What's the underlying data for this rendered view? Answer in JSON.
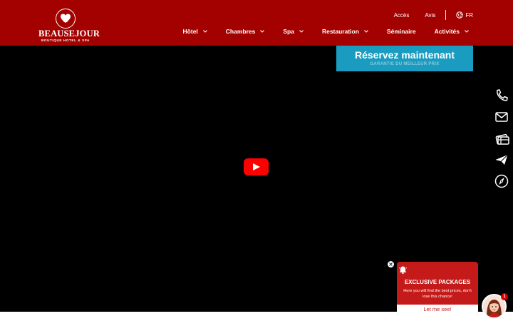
{
  "logo": {
    "brand": "BEAUSEJOUR",
    "tagline": "BOUTIQUE HOTEL & SPA"
  },
  "top_links": {
    "acces": "Accès",
    "avis": "Avis",
    "lang": "FR"
  },
  "nav": {
    "items": [
      {
        "label": "Hôtel",
        "has_dropdown": true
      },
      {
        "label": "Chambres",
        "has_dropdown": true
      },
      {
        "label": "Spa",
        "has_dropdown": true
      },
      {
        "label": "Restauration",
        "has_dropdown": true
      },
      {
        "label": "Séminaire",
        "has_dropdown": false
      },
      {
        "label": "Activités",
        "has_dropdown": true
      }
    ]
  },
  "reserve": {
    "title": "Réservez maintenant",
    "subtitle": "GARANTIE DU MEILLEUR PRIX"
  },
  "side_rail": {
    "icons": [
      "phone-icon",
      "mail-icon",
      "gift-voucher-icon",
      "send-icon",
      "compass-icon"
    ]
  },
  "popup": {
    "title": "EXCLUSIVE PACKAGES",
    "text": "Here you will find the best prices, don't lose this chance!",
    "button": "Let me see!"
  },
  "chat_badge": "1",
  "colors": {
    "header": "#a30000",
    "reserve": "#1a9cc0",
    "popup": "#c41a1a",
    "play": "#ff0000"
  }
}
